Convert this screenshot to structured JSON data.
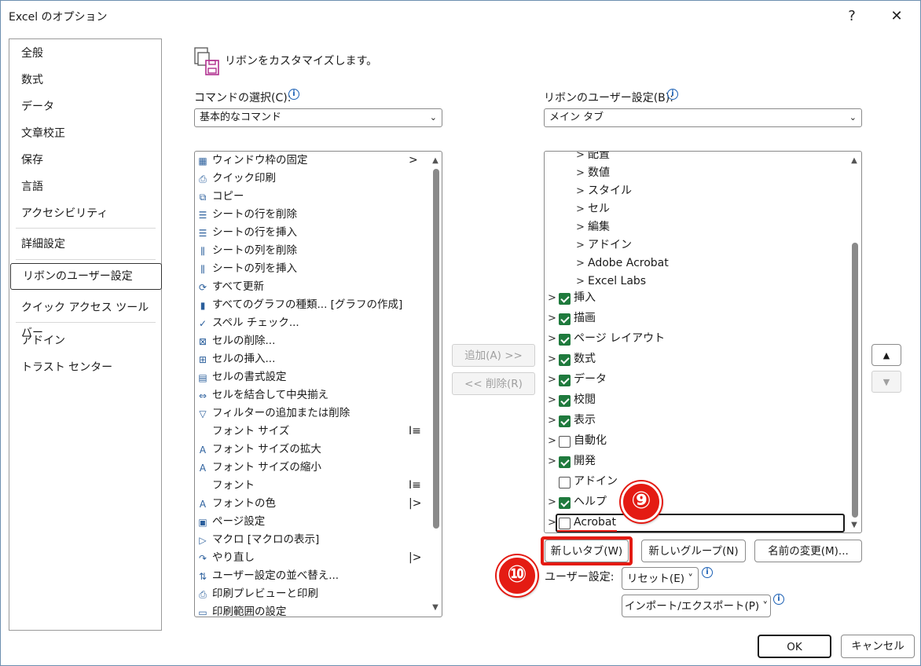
{
  "window": {
    "title": "Excel のオプション",
    "help": "?",
    "close": "✕"
  },
  "nav": {
    "items": [
      "全般",
      "数式",
      "データ",
      "文章校正",
      "保存",
      "言語",
      "アクセシビリティ",
      "詳細設定",
      "リボンのユーザー設定",
      "クイック アクセス ツール バー",
      "アドイン",
      "トラスト センター"
    ],
    "selected": "リボンのユーザー設定"
  },
  "heading": "リボンをカスタマイズします。",
  "left": {
    "label": "コマンドの選択(C):",
    "select_value": "基本的なコマンド",
    "commands": [
      {
        "icon": "freeze-panes-icon",
        "glyph": "▦",
        "text": "ウィンドウ枠の固定",
        "sub": ">"
      },
      {
        "icon": "quick-print-icon",
        "glyph": "⎙",
        "text": "クイック印刷"
      },
      {
        "icon": "copy-icon",
        "glyph": "⧉",
        "text": "コピー"
      },
      {
        "icon": "delete-row-icon",
        "glyph": "☰",
        "text": "シートの行を削除"
      },
      {
        "icon": "insert-row-icon",
        "glyph": "☰",
        "text": "シートの行を挿入"
      },
      {
        "icon": "delete-column-icon",
        "glyph": "⫼",
        "text": "シートの列を削除"
      },
      {
        "icon": "insert-column-icon",
        "glyph": "⫼",
        "text": "シートの列を挿入"
      },
      {
        "icon": "refresh-all-icon",
        "glyph": "⟳",
        "text": "すべて更新"
      },
      {
        "icon": "chart-types-icon",
        "glyph": "▮",
        "text": "すべてのグラフの種類... [グラフの作成]"
      },
      {
        "icon": "spell-check-icon",
        "glyph": "✓",
        "text": "スペル チェック..."
      },
      {
        "icon": "delete-cells-icon",
        "glyph": "⊠",
        "text": "セルの削除..."
      },
      {
        "icon": "insert-cells-icon",
        "glyph": "⊞",
        "text": "セルの挿入..."
      },
      {
        "icon": "format-cells-icon",
        "glyph": "▤",
        "text": "セルの書式設定"
      },
      {
        "icon": "merge-center-icon",
        "glyph": "⇔",
        "text": "セルを結合して中央揃え"
      },
      {
        "icon": "filter-icon",
        "glyph": "▽",
        "text": "フィルターの追加または削除"
      },
      {
        "icon": "",
        "glyph": "",
        "text": "フォント サイズ",
        "sub": "I≡"
      },
      {
        "icon": "font-size-increase-icon",
        "glyph": "A",
        "text": "フォント サイズの拡大"
      },
      {
        "icon": "font-size-decrease-icon",
        "glyph": "A",
        "text": "フォント サイズの縮小"
      },
      {
        "icon": "",
        "glyph": "",
        "text": "フォント",
        "sub": "I≡"
      },
      {
        "icon": "font-color-icon",
        "glyph": "A",
        "text": "フォントの色",
        "sub": "|>"
      },
      {
        "icon": "page-setup-icon",
        "glyph": "▣",
        "text": "ページ設定"
      },
      {
        "icon": "macro-icon",
        "glyph": "▷",
        "text": "マクロ [マクロの表示]"
      },
      {
        "icon": "redo-icon",
        "glyph": "↷",
        "text": "やり直し",
        "sub": "|>"
      },
      {
        "icon": "sort-icon",
        "glyph": "⇅",
        "text": "ユーザー設定の並べ替え..."
      },
      {
        "icon": "print-preview-icon",
        "glyph": "⎙",
        "text": "印刷プレビューと印刷"
      },
      {
        "icon": "print-area-icon",
        "glyph": "▭",
        "text": "印刷範囲の設定"
      }
    ]
  },
  "middle": {
    "add": "追加(A) >>",
    "remove": "<< 削除(R)"
  },
  "right": {
    "label": "リボンのユーザー設定(B):",
    "select_value": "メイン タブ",
    "groups": [
      "配置",
      "数値",
      "スタイル",
      "セル",
      "編集",
      "アドイン",
      "Adobe Acrobat",
      "Excel Labs"
    ],
    "tabs": [
      {
        "name": "挿入",
        "checked": true,
        "expandable": true
      },
      {
        "name": "描画",
        "checked": true,
        "expandable": true
      },
      {
        "name": "ページ レイアウト",
        "checked": true,
        "expandable": true
      },
      {
        "name": "数式",
        "checked": true,
        "expandable": true
      },
      {
        "name": "データ",
        "checked": true,
        "expandable": true
      },
      {
        "name": "校閲",
        "checked": true,
        "expandable": true
      },
      {
        "name": "表示",
        "checked": true,
        "expandable": true
      },
      {
        "name": "自動化",
        "checked": false,
        "expandable": true
      },
      {
        "name": "開発",
        "checked": true,
        "expandable": true
      },
      {
        "name": "アドイン",
        "checked": false,
        "expandable": false
      },
      {
        "name": "ヘルプ",
        "checked": true,
        "expandable": true
      },
      {
        "name": "Acrobat",
        "checked": false,
        "expandable": true
      }
    ],
    "new_tab": "新しいタブ(W)",
    "new_group": "新しいグループ(N)",
    "rename": "名前の変更(M)...",
    "user_settings_label": "ユーザー設定:",
    "reset": "リセット(E) ˅",
    "import_export": "インポート/エクスポート(P) ˅"
  },
  "callouts": {
    "nine": "⑨",
    "ten": "⑩"
  },
  "footer": {
    "ok": "OK",
    "cancel": "キャンセル"
  },
  "colors": {
    "accent_red": "#e41b13",
    "check_green": "#1f7a3d"
  }
}
